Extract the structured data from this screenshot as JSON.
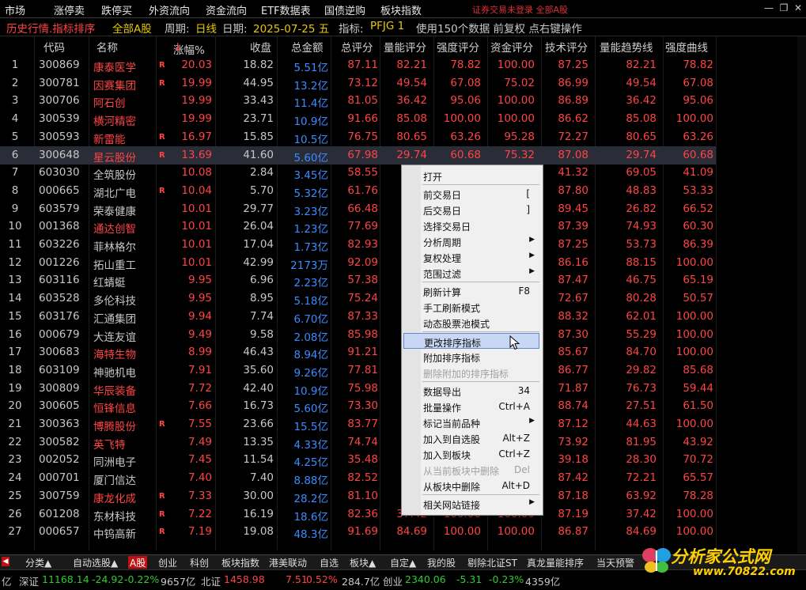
{
  "menu": {
    "items": [
      "市场",
      "涨停卖",
      "跌停买",
      "外资流向",
      "资金流向",
      "ETF数据表",
      "国债逆购",
      "板块指数"
    ],
    "notice": "证券交易未登录  全部A股"
  },
  "info": {
    "title": "历史行情.指标排序",
    "scope": "全部A股",
    "period_label": "周期:",
    "period": "日线",
    "date_label": "日期:",
    "date": "2025-07-25 五",
    "indicator_label": "指标:",
    "indicator": "PFJG 1",
    "note": "使用150个数据 前复权 点右键操作"
  },
  "columns": [
    "代码",
    "名称",
    "涨幅%",
    "收盘",
    "总金额",
    "总评分",
    "量能评分",
    "强度评分",
    "资金评分",
    "技术评分",
    "量能趋势线",
    "强度曲线"
  ],
  "sort_arrow": "↓",
  "rows": [
    {
      "i": "1",
      "code": "300869",
      "name": "康泰医学",
      "r": "R",
      "chg": "20.03",
      "close": "18.82",
      "amt": "5.51亿",
      "s": [
        "87.11",
        "82.21",
        "78.82",
        "100.00",
        "87.25",
        "82.21",
        "78.82"
      ],
      "nc": "red"
    },
    {
      "i": "2",
      "code": "300781",
      "name": "因赛集团",
      "r": "R",
      "chg": "19.99",
      "close": "44.95",
      "amt": "13.2亿",
      "s": [
        "73.12",
        "49.54",
        "67.08",
        "75.02",
        "86.99",
        "49.54",
        "67.08"
      ],
      "nc": "red"
    },
    {
      "i": "3",
      "code": "300706",
      "name": "阿石创",
      "r": "",
      "chg": "19.99",
      "close": "33.43",
      "amt": "11.4亿",
      "s": [
        "81.05",
        "36.42",
        "95.06",
        "100.00",
        "86.89",
        "36.42",
        "95.06"
      ],
      "nc": "red"
    },
    {
      "i": "4",
      "code": "300539",
      "name": "横河精密",
      "r": "",
      "chg": "19.99",
      "close": "23.71",
      "amt": "10.9亿",
      "s": [
        "91.66",
        "85.08",
        "100.00",
        "100.00",
        "86.62",
        "85.08",
        "100.00"
      ],
      "nc": "red"
    },
    {
      "i": "5",
      "code": "300593",
      "name": "新雷能",
      "r": "R",
      "chg": "16.97",
      "close": "15.85",
      "amt": "10.5亿",
      "s": [
        "76.75",
        "80.65",
        "63.26",
        "95.28",
        "72.27",
        "80.65",
        "63.26"
      ],
      "nc": "red"
    },
    {
      "i": "6",
      "code": "300648",
      "name": "星云股份",
      "r": "R",
      "chg": "13.69",
      "close": "41.60",
      "amt": "5.60亿",
      "s": [
        "67.98",
        "29.74",
        "60.68",
        "75.32",
        "87.08",
        "29.74",
        "60.68"
      ],
      "nc": "red"
    },
    {
      "i": "7",
      "code": "603030",
      "name": "全筑股份",
      "r": "",
      "chg": "10.08",
      "close": "2.84",
      "amt": "3.45亿",
      "s": [
        "58.55",
        "",
        "",
        "",
        "41.32",
        "69.05",
        "41.09"
      ],
      "nc": "gray"
    },
    {
      "i": "8",
      "code": "000665",
      "name": "湖北广电",
      "r": "R",
      "chg": "10.04",
      "close": "5.70",
      "amt": "5.32亿",
      "s": [
        "61.76",
        "",
        "",
        "",
        "87.80",
        "48.83",
        "53.33"
      ],
      "nc": "gray"
    },
    {
      "i": "9",
      "code": "603579",
      "name": "荣泰健康",
      "r": "",
      "chg": "10.01",
      "close": "29.77",
      "amt": "3.23亿",
      "s": [
        "66.48",
        "",
        "",
        "",
        "89.45",
        "26.82",
        "66.52"
      ],
      "nc": "gray"
    },
    {
      "i": "10",
      "code": "001368",
      "name": "通达创智",
      "r": "",
      "chg": "10.01",
      "close": "26.04",
      "amt": "1.23亿",
      "s": [
        "77.69",
        "",
        "",
        "",
        "87.39",
        "74.93",
        "60.30"
      ],
      "nc": "red"
    },
    {
      "i": "11",
      "code": "603226",
      "name": "菲林格尔",
      "r": "",
      "chg": "10.01",
      "close": "17.04",
      "amt": "1.73亿",
      "s": [
        "82.93",
        "",
        "",
        "",
        "87.25",
        "53.73",
        "86.39"
      ],
      "nc": "gray"
    },
    {
      "i": "12",
      "code": "001226",
      "name": "拓山重工",
      "r": "",
      "chg": "10.01",
      "close": "42.99",
      "amt": "2173万",
      "s": [
        "92.09",
        "",
        "",
        "",
        "86.16",
        "88.15",
        "100.00"
      ],
      "nc": "gray"
    },
    {
      "i": "13",
      "code": "603116",
      "name": "红蜻蜓",
      "r": "",
      "chg": "9.95",
      "close": "6.96",
      "amt": "2.23亿",
      "s": [
        "57.38",
        "",
        "",
        "",
        "87.47",
        "46.75",
        "65.19"
      ],
      "nc": "gray"
    },
    {
      "i": "14",
      "code": "603528",
      "name": "多伦科技",
      "r": "",
      "chg": "9.95",
      "close": "8.95",
      "amt": "5.18亿",
      "s": [
        "75.24",
        "",
        "",
        "",
        "72.67",
        "80.28",
        "50.57"
      ],
      "nc": "gray"
    },
    {
      "i": "15",
      "code": "603176",
      "name": "汇通集团",
      "r": "",
      "chg": "9.94",
      "close": "7.74",
      "amt": "6.70亿",
      "s": [
        "87.33",
        "",
        "",
        "",
        "88.32",
        "62.01",
        "100.00"
      ],
      "nc": "gray"
    },
    {
      "i": "16",
      "code": "000679",
      "name": "大连友谊",
      "r": "",
      "chg": "9.49",
      "close": "9.58",
      "amt": "2.08亿",
      "s": [
        "85.98",
        "",
        "",
        "",
        "87.30",
        "55.29",
        "100.00"
      ],
      "nc": "gray"
    },
    {
      "i": "17",
      "code": "300683",
      "name": "海特生物",
      "r": "",
      "chg": "8.99",
      "close": "46.43",
      "amt": "8.94亿",
      "s": [
        "91.21",
        "",
        "",
        "",
        "85.67",
        "84.70",
        "100.00"
      ],
      "nc": "red"
    },
    {
      "i": "18",
      "code": "603109",
      "name": "神驰机电",
      "r": "",
      "chg": "7.91",
      "close": "35.60",
      "amt": "9.26亿",
      "s": [
        "77.81",
        "",
        "",
        "",
        "86.77",
        "29.82",
        "85.68"
      ],
      "nc": "gray"
    },
    {
      "i": "19",
      "code": "300809",
      "name": "华辰装备",
      "r": "",
      "chg": "7.72",
      "close": "42.40",
      "amt": "10.9亿",
      "s": [
        "75.98",
        "",
        "",
        "",
        "71.87",
        "76.73",
        "59.44"
      ],
      "nc": "red"
    },
    {
      "i": "20",
      "code": "300605",
      "name": "恒锋信息",
      "r": "",
      "chg": "7.66",
      "close": "16.73",
      "amt": "5.60亿",
      "s": [
        "73.30",
        "",
        "",
        "",
        "88.74",
        "27.51",
        "61.50"
      ],
      "nc": "red"
    },
    {
      "i": "21",
      "code": "300363",
      "name": "博腾股份",
      "r": "R",
      "chg": "7.55",
      "close": "23.66",
      "amt": "15.5亿",
      "s": [
        "83.77",
        "",
        "",
        "",
        "87.12",
        "44.63",
        "100.00"
      ],
      "nc": "red"
    },
    {
      "i": "22",
      "code": "300582",
      "name": "英飞特",
      "r": "",
      "chg": "7.49",
      "close": "13.35",
      "amt": "4.33亿",
      "s": [
        "74.74",
        "",
        "",
        "",
        "73.92",
        "81.95",
        "43.92"
      ],
      "nc": "red"
    },
    {
      "i": "23",
      "code": "002052",
      "name": "同洲电子",
      "r": "",
      "chg": "7.45",
      "close": "11.54",
      "amt": "4.25亿",
      "s": [
        "35.48",
        "",
        "",
        "",
        "39.18",
        "28.30",
        "70.72"
      ],
      "nc": "gray"
    },
    {
      "i": "24",
      "code": "000701",
      "name": "厦门信达",
      "r": "",
      "chg": "7.40",
      "close": "7.40",
      "amt": "8.88亿",
      "s": [
        "82.52",
        "",
        "",
        "",
        "87.42",
        "72.21",
        "65.57"
      ],
      "nc": "gray"
    },
    {
      "i": "25",
      "code": "300759",
      "name": "康龙化成",
      "r": "R",
      "chg": "7.33",
      "close": "30.00",
      "amt": "28.2亿",
      "s": [
        "81.10",
        "",
        "",
        "",
        "87.18",
        "63.92",
        "78.28"
      ],
      "nc": "red"
    },
    {
      "i": "26",
      "code": "601208",
      "name": "东材科技",
      "r": "R",
      "chg": "7.22",
      "close": "16.19",
      "amt": "18.6亿",
      "s": [
        "82.36",
        "37.42",
        "100.00",
        "100.00",
        "87.19",
        "37.42",
        "100.00"
      ],
      "nc": "gray"
    },
    {
      "i": "27",
      "code": "000657",
      "name": "中钨高新",
      "r": "R",
      "chg": "7.19",
      "close": "19.08",
      "amt": "48.3亿",
      "s": [
        "91.69",
        "84.69",
        "100.00",
        "100.00",
        "86.87",
        "84.69",
        "100.00"
      ],
      "nc": "gray"
    }
  ],
  "context_menu": [
    {
      "label": "打开",
      "shortcut": "",
      "arrow": false,
      "disabled": false,
      "sep_after": true
    },
    {
      "label": "前交易日",
      "shortcut": "[",
      "arrow": false,
      "disabled": false,
      "sep_after": false
    },
    {
      "label": "后交易日",
      "shortcut": "]",
      "arrow": false,
      "disabled": false,
      "sep_after": false
    },
    {
      "label": "选择交易日",
      "shortcut": "",
      "arrow": false,
      "disabled": false,
      "sep_after": false
    },
    {
      "label": "分析周期",
      "shortcut": "",
      "arrow": true,
      "disabled": false,
      "sep_after": false
    },
    {
      "label": "复权处理",
      "shortcut": "",
      "arrow": true,
      "disabled": false,
      "sep_after": false
    },
    {
      "label": "范围过滤",
      "shortcut": "",
      "arrow": true,
      "disabled": false,
      "sep_after": true
    },
    {
      "label": "刷新计算",
      "shortcut": "F8",
      "arrow": false,
      "disabled": false,
      "sep_after": false
    },
    {
      "label": "手工刷新模式",
      "shortcut": "",
      "arrow": false,
      "disabled": false,
      "sep_after": false
    },
    {
      "label": "动态股票池模式",
      "shortcut": "",
      "arrow": false,
      "disabled": false,
      "sep_after": true
    },
    {
      "label": "更改排序指标",
      "shortcut": "",
      "arrow": false,
      "disabled": false,
      "sep_after": false,
      "highlight": true
    },
    {
      "label": "附加排序指标",
      "shortcut": "",
      "arrow": false,
      "disabled": false,
      "sep_after": false
    },
    {
      "label": "删除附加的排序指标",
      "shortcut": "",
      "arrow": false,
      "disabled": true,
      "sep_after": true
    },
    {
      "label": "数据导出",
      "shortcut": "34",
      "arrow": false,
      "disabled": false,
      "sep_after": false
    },
    {
      "label": "批量操作",
      "shortcut": "Ctrl+A",
      "arrow": false,
      "disabled": false,
      "sep_after": false
    },
    {
      "label": "标记当前品种",
      "shortcut": "",
      "arrow": true,
      "disabled": false,
      "sep_after": false
    },
    {
      "label": "加入到自选股",
      "shortcut": "Alt+Z",
      "arrow": false,
      "disabled": false,
      "sep_after": false
    },
    {
      "label": "加入到板块",
      "shortcut": "Ctrl+Z",
      "arrow": false,
      "disabled": false,
      "sep_after": false
    },
    {
      "label": "从当前板块中删除",
      "shortcut": "Del",
      "arrow": false,
      "disabled": true,
      "sep_after": false
    },
    {
      "label": "从板块中删除",
      "shortcut": "Alt+D",
      "arrow": false,
      "disabled": false,
      "sep_after": true
    },
    {
      "label": "相关网站链接",
      "shortcut": "",
      "arrow": true,
      "disabled": false,
      "sep_after": false
    }
  ],
  "tabs": [
    {
      "label": "分类▲",
      "active": false
    },
    {
      "label": "自动选股▲",
      "active": false
    },
    {
      "label": "A股",
      "active": true
    },
    {
      "label": "创业",
      "active": false
    },
    {
      "label": "科创",
      "active": false
    },
    {
      "label": "板块指数",
      "active": false
    },
    {
      "label": "港美联动",
      "active": false
    },
    {
      "label": "自选",
      "active": false
    },
    {
      "label": "板块▲",
      "active": false
    },
    {
      "label": "自定▲",
      "active": false
    },
    {
      "label": "我的股",
      "active": false
    },
    {
      "label": "剔除北证ST",
      "active": false
    },
    {
      "label": "真龙量能排序",
      "active": false
    },
    {
      "label": "当天预警",
      "active": false
    }
  ],
  "status": {
    "prefix": "亿",
    "sz_label": "深证",
    "sz_val": "11168.14",
    "sz_chg": "-24.92",
    "sz_pct": "-0.22%",
    "sz_amt": "9657亿",
    "bz_label": "北证",
    "bz_val": "1458.98",
    "bz_chg": "7.51",
    "bz_pct": "0.52%",
    "bz_amt": "284.7亿",
    "cy_label": "创业",
    "cy_val": "2340.06",
    "cy_chg": "-5.31",
    "cy_pct": "-0.23%",
    "cy_amt": "4359亿"
  },
  "logo": {
    "line1": "分析家公式网",
    "line2": "www.70822.com"
  },
  "colors": {
    "up": "#ff4444",
    "down": "#2ecc2e",
    "amount": "#3a8cff",
    "accent": "#e8c800"
  }
}
